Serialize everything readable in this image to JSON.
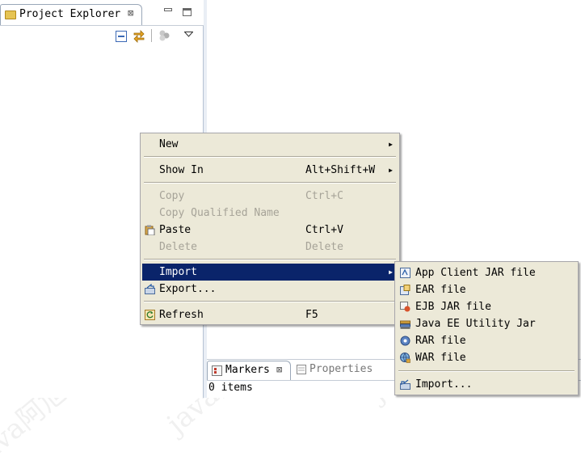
{
  "project_explorer": {
    "tab_label": "Project Explorer",
    "close_glyph": "⊠",
    "toolbar": [
      "collapse-all-icon",
      "link-with-editor-icon",
      "filter-icon",
      "view-menu-icon"
    ]
  },
  "context_menu": {
    "items": [
      {
        "label": "New",
        "accelerator": "",
        "submenu": true,
        "enabled": true
      },
      {
        "label": "Show In",
        "accelerator": "Alt+Shift+W",
        "submenu": true,
        "enabled": true
      },
      {
        "label": "Copy",
        "accelerator": "Ctrl+C",
        "submenu": false,
        "enabled": false
      },
      {
        "label": "Copy Qualified Name",
        "accelerator": "",
        "submenu": false,
        "enabled": false
      },
      {
        "label": "Paste",
        "accelerator": "Ctrl+V",
        "submenu": false,
        "enabled": true
      },
      {
        "label": "Delete",
        "accelerator": "Delete",
        "submenu": false,
        "enabled": false
      },
      {
        "label": "Import",
        "accelerator": "",
        "submenu": true,
        "enabled": true,
        "selected": true
      },
      {
        "label": "Export...",
        "accelerator": "",
        "submenu": false,
        "enabled": true
      },
      {
        "label": "Refresh",
        "accelerator": "F5",
        "submenu": false,
        "enabled": true
      }
    ],
    "submenu_arrow": "▶"
  },
  "import_submenu": {
    "items": [
      {
        "label": "App Client JAR file",
        "icon": "app-client-jar-icon"
      },
      {
        "label": "EAR file",
        "icon": "ear-file-icon"
      },
      {
        "label": "EJB JAR file",
        "icon": "ejb-jar-icon"
      },
      {
        "label": "Java EE Utility Jar",
        "icon": "utility-jar-icon"
      },
      {
        "label": "RAR file",
        "icon": "rar-file-icon"
      },
      {
        "label": "WAR file",
        "icon": "war-file-icon"
      },
      {
        "label": "Import...",
        "icon": "import-wizard-icon"
      }
    ]
  },
  "markers_view": {
    "tabs": [
      {
        "label": "Markers",
        "active": true
      },
      {
        "label": "Properties",
        "active": false
      }
    ],
    "close_glyph": "⊠",
    "status": "0 items"
  },
  "watermark": "java阿旭 CSDN",
  "colors": {
    "selection": "#0a246a",
    "menu_bg": "#ece9d8",
    "disabled_text": "#a6a398"
  }
}
